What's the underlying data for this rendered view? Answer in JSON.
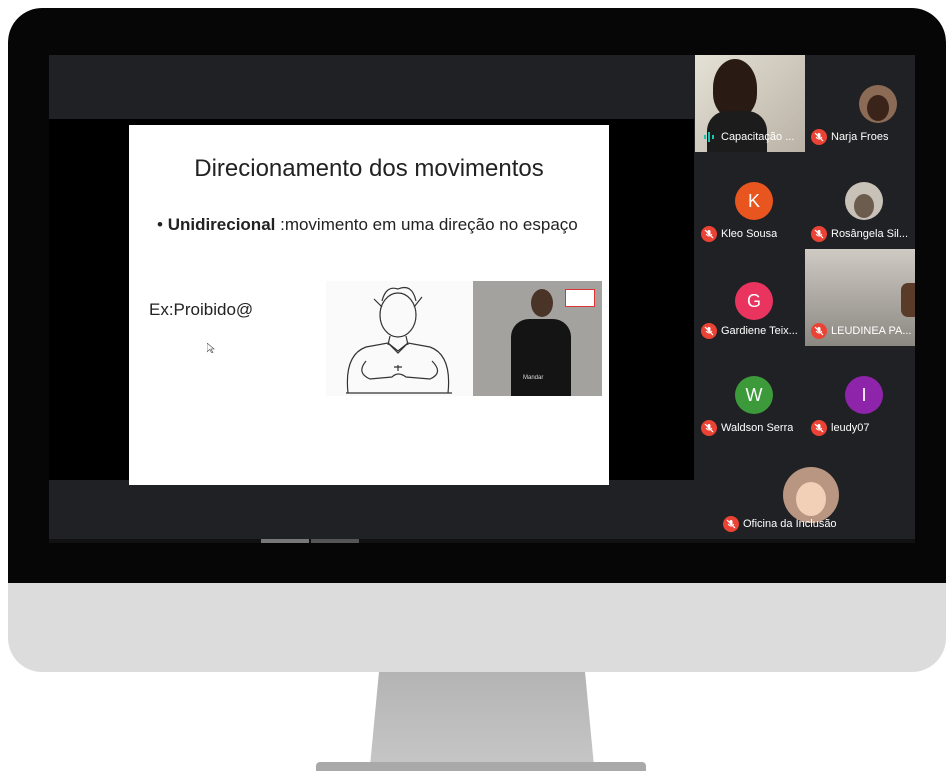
{
  "slide": {
    "title": "Direcionamento dos movimentos",
    "bullet_bold": "Unidirecional",
    "bullet_rest": " :movimento em uma direção no espaço",
    "example": "Ex:Proibido@",
    "shirt_text": "Mandar"
  },
  "participants": [
    {
      "name": "Capacitação ...",
      "mic": "speaking",
      "avatar": "camera"
    },
    {
      "name": "Narja Froes",
      "mic": "muted",
      "avatar": "photo"
    },
    {
      "name": "Kleo Sousa",
      "mic": "muted",
      "avatar": "initial",
      "initial": "K",
      "color": "#e8551f"
    },
    {
      "name": "Rosângela Sil...",
      "mic": "muted",
      "avatar": "photo"
    },
    {
      "name": "Gardiene Teix...",
      "mic": "muted",
      "avatar": "initial",
      "initial": "G",
      "color": "#e8345f"
    },
    {
      "name": "LEUDINEA PA...",
      "mic": "muted",
      "avatar": "camera"
    },
    {
      "name": "Waldson Serra",
      "mic": "muted",
      "avatar": "initial",
      "initial": "W",
      "color": "#3d9a3b"
    },
    {
      "name": "leudy07",
      "mic": "muted",
      "avatar": "initial",
      "initial": "I",
      "color": "#8e24aa"
    },
    {
      "name": "Oficina da Inclusão",
      "mic": "muted",
      "avatar": "photo"
    }
  ],
  "colors": {
    "muted": "#ea4335",
    "speaking": "#1ec5b0",
    "tile": "#3c4043",
    "background": "#202124"
  }
}
